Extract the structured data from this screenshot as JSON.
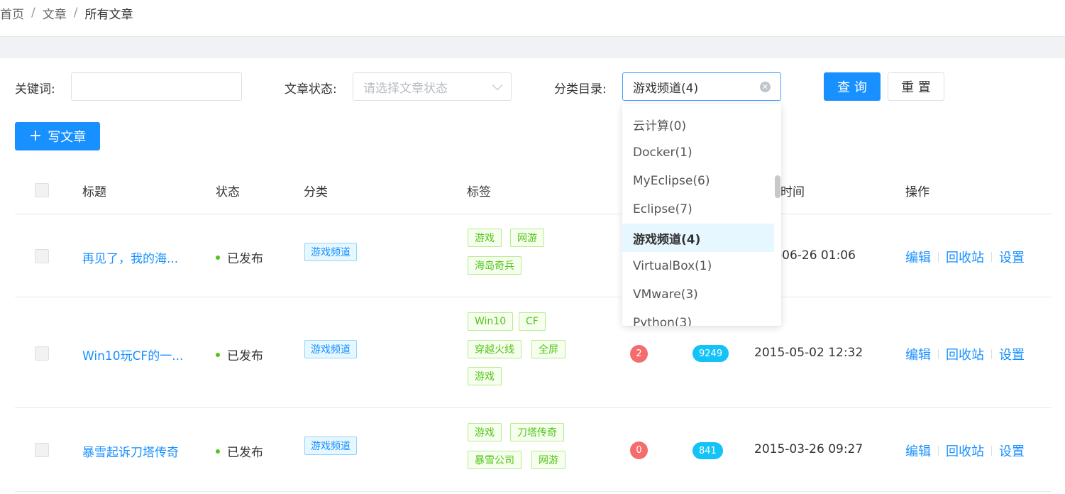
{
  "breadcrumb": {
    "home": "首页",
    "section": "文章",
    "current": "所有文章",
    "sep": "/"
  },
  "filters": {
    "keyword_label": "关键词:",
    "keyword_value": "",
    "status_label": "文章状态:",
    "status_placeholder": "请选择文章状态",
    "category_label": "分类目录:",
    "category_value": "游戏频道(4)",
    "query_button": "查 询",
    "reset_button": "重 置"
  },
  "write_button": {
    "icon": "plus-icon",
    "label": "写文章"
  },
  "table": {
    "headers": {
      "title": "标题",
      "status": "状态",
      "category": "分类",
      "tags": "标签",
      "time": "时间",
      "actions": "操作"
    },
    "rows": [
      {
        "title": "再见了，我的海...",
        "status": "已发布",
        "category": "游戏频道",
        "tags": [
          "游戏",
          "网游",
          "海岛奇兵"
        ],
        "comments": "",
        "views": "",
        "time": "-06-26 01:06",
        "actions": [
          "编辑",
          "回收站",
          "设置"
        ]
      },
      {
        "title": "Win10玩CF的一...",
        "status": "已发布",
        "category": "游戏频道",
        "tags": [
          "Win10",
          "CF",
          "穿越火线",
          "全屏",
          "游戏"
        ],
        "comments": "2",
        "views": "9249",
        "time": "2015-05-02 12:32",
        "actions": [
          "编辑",
          "回收站",
          "设置"
        ]
      },
      {
        "title": "暴雪起诉刀塔传奇",
        "status": "已发布",
        "category": "游戏频道",
        "tags": [
          "游戏",
          "刀塔传奇",
          "暴雪公司",
          "网游"
        ],
        "comments": "0",
        "views": "841",
        "time": "2015-03-26 09:27",
        "actions": [
          "编辑",
          "回收站",
          "设置"
        ]
      }
    ]
  },
  "dropdown": {
    "items": [
      "云计算(0)",
      "Docker(1)",
      "MyEclipse(6)",
      "Eclipse(7)",
      "游戏频道(4)",
      "VirtualBox(1)",
      "VMware(3)",
      "Python(3)"
    ],
    "selected_index": 4
  },
  "colors": {
    "primary": "#1890ff",
    "success": "#52c41a",
    "danger": "#f56c6c",
    "cyan": "#13c2f7"
  }
}
